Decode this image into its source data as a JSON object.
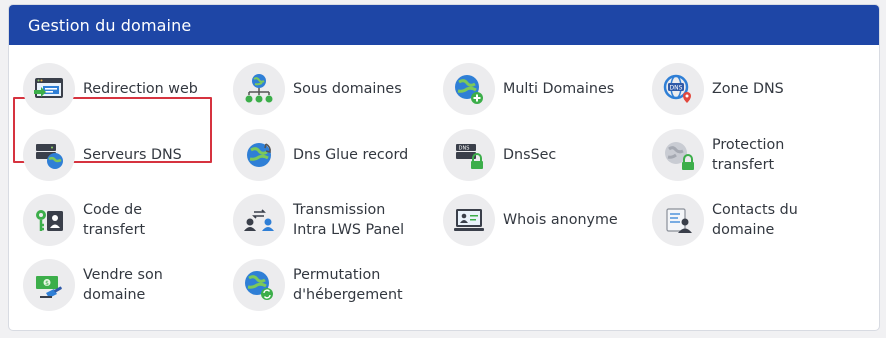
{
  "panel": {
    "title": "Gestion du domaine"
  },
  "colors": {
    "header": "#1e46a6",
    "highlight": "#d6333f",
    "icon_bg": "#ececee"
  },
  "items": [
    {
      "label": "Redirection web",
      "icon": "web-redirect-icon"
    },
    {
      "label": "Sous domaines",
      "icon": "subdomains-icon"
    },
    {
      "label": "Multi Domaines",
      "icon": "multi-domains-icon"
    },
    {
      "label": "Zone DNS",
      "icon": "dns-zone-icon"
    },
    {
      "label": "Serveurs DNS",
      "icon": "dns-servers-icon"
    },
    {
      "label": "Dns Glue record",
      "icon": "glue-record-icon"
    },
    {
      "label": "DnsSec",
      "icon": "dnssec-icon"
    },
    {
      "label": "Protection\ntransfert",
      "icon": "transfer-protection-icon"
    },
    {
      "label": "Code de\ntransfert",
      "icon": "transfer-code-icon"
    },
    {
      "label": "Transmission\nIntra LWS Panel",
      "icon": "transmission-icon"
    },
    {
      "label": "Whois anonyme",
      "icon": "whois-anonymous-icon"
    },
    {
      "label": "Contacts du\ndomaine",
      "icon": "domain-contacts-icon"
    },
    {
      "label": "Vendre son\ndomaine",
      "icon": "sell-domain-icon"
    },
    {
      "label": "Permutation\nd'hébergement",
      "icon": "hosting-swap-icon"
    }
  ],
  "selected_item": "Redirection web"
}
